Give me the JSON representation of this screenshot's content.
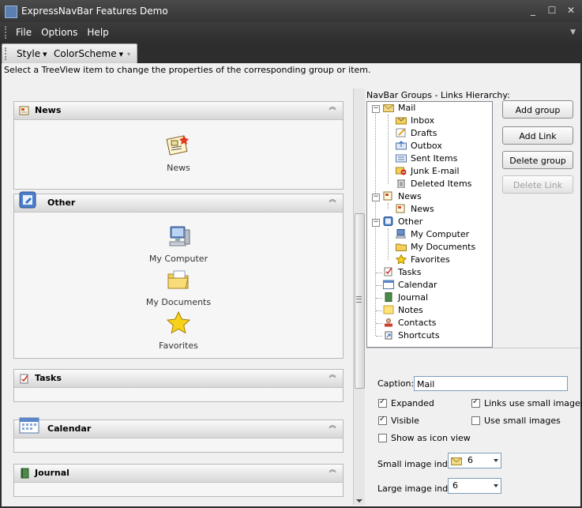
{
  "window": {
    "title": "ExpressNavBar Features Demo",
    "buttons": [
      "_",
      "☐",
      "✕"
    ]
  },
  "menu": {
    "items": [
      {
        "label": "File"
      },
      {
        "label": "Options"
      },
      {
        "label": "Help"
      }
    ]
  },
  "toolbar": {
    "style_label": "Style",
    "colorscheme_label": "ColorScheme"
  },
  "hint": "Select a TreeView item to change the properties of the corresponding group or item.",
  "navbar": {
    "groups": [
      {
        "title": "News",
        "icon": "news-icon",
        "items": [
          {
            "label": "News",
            "icon": "news-icon"
          }
        ]
      },
      {
        "title": "Other",
        "icon": "other-icon",
        "items": [
          {
            "label": "My Computer",
            "icon": "my-computer-icon"
          },
          {
            "label": "My Documents",
            "icon": "my-documents-icon"
          },
          {
            "label": "Favorites",
            "icon": "favorites-star-icon"
          }
        ]
      },
      {
        "title": "Tasks",
        "icon": "tasks-icon",
        "items": []
      },
      {
        "title": "Calendar",
        "icon": "calendar-icon",
        "items": []
      },
      {
        "title": "Journal",
        "icon": "journal-icon",
        "items": []
      }
    ]
  },
  "tree": {
    "label": "NavBar Groups - Links Hierarchy:",
    "nodes": [
      {
        "label": "Mail",
        "icon": "mail-icon",
        "expanded": true,
        "children": [
          "Inbox",
          "Drafts",
          "Outbox",
          "Sent Items",
          "Junk E-mail",
          "Deleted Items"
        ]
      },
      {
        "label": "News",
        "icon": "news-icon",
        "expanded": true,
        "children": [
          "News"
        ]
      },
      {
        "label": "Other",
        "icon": "other-icon",
        "expanded": true,
        "children": [
          "My Computer",
          "My Documents",
          "Favorites"
        ]
      },
      {
        "label": "Tasks",
        "icon": "tasks-icon"
      },
      {
        "label": "Calendar",
        "icon": "calendar-icon"
      },
      {
        "label": "Journal",
        "icon": "journal-icon"
      },
      {
        "label": "Notes",
        "icon": "notes-icon"
      },
      {
        "label": "Contacts",
        "icon": "contacts-icon"
      },
      {
        "label": "Shortcuts",
        "icon": "shortcuts-icon"
      }
    ]
  },
  "buttons": {
    "add_group": "Add group",
    "add_link": "Add Link",
    "delete_group": "Delete group",
    "delete_link": "Delete Link"
  },
  "properties": {
    "caption_label": "Caption:",
    "caption_value": "Mail",
    "expanded_label": "Expanded",
    "expanded": true,
    "visible_label": "Visible",
    "visible": true,
    "show_icon_view_label": "Show as icon view",
    "show_icon_view": false,
    "links_small_images_label": "Links use small images",
    "links_small_images": true,
    "use_small_images_label": "Use small images",
    "use_small_images": false,
    "small_index_label": "Small image index:",
    "small_index_value": "6",
    "large_index_label": "Large image index:",
    "large_index_value": "6"
  },
  "colors": {
    "titlebar": "#3a3a3a",
    "panel": "#f0f0f0",
    "accent": "#5a7fb0"
  }
}
